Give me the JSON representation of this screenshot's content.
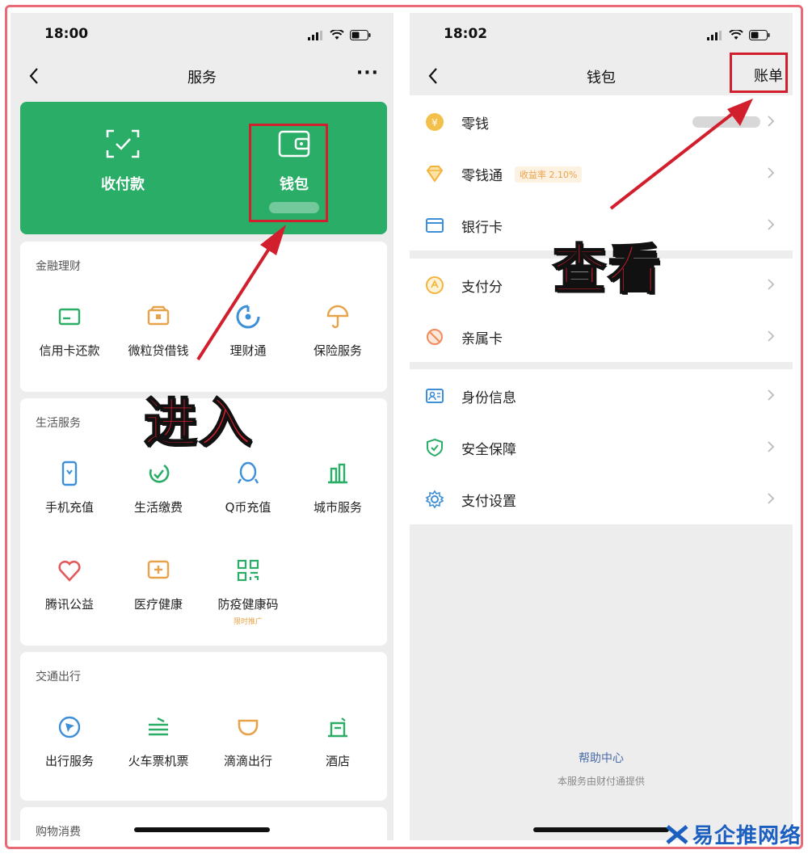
{
  "left": {
    "status_time": "18:00",
    "nav_title": "服务",
    "nav_more": "···",
    "green_card": {
      "pay_label": "收付款",
      "wallet_label": "钱包"
    },
    "finance": {
      "title": "金融理财",
      "items": [
        "信用卡还款",
        "微粒贷借钱",
        "理财通",
        "保险服务"
      ]
    },
    "life": {
      "title": "生活服务",
      "items": [
        "手机充值",
        "生活缴费",
        "Q币充值",
        "城市服务",
        "腾讯公益",
        "医疗健康",
        "防疫健康码"
      ],
      "health_code_sub": "限时推广"
    },
    "transport": {
      "title": "交通出行",
      "items": [
        "出行服务",
        "火车票机票",
        "滴滴出行",
        "酒店"
      ]
    },
    "shopping": {
      "title": "购物消费"
    }
  },
  "right": {
    "status_time": "18:02",
    "nav_title": "钱包",
    "nav_bill": "账单",
    "group1": [
      "零钱",
      "零钱通",
      "银行卡"
    ],
    "lingqiantong_badge": "收益率 2.10%",
    "group2": [
      "支付分",
      "亲属卡"
    ],
    "group3": [
      "身份信息",
      "安全保障",
      "支付设置"
    ],
    "help": "帮助中心",
    "provider": "本服务由财付通提供"
  },
  "annotations": {
    "enter": "进入",
    "view": "查看"
  },
  "watermark": "易企推网络",
  "colors": {
    "green": "#2aad67",
    "annotation_red": "#d21f2d",
    "accent_orange": "#e8a34a",
    "accent_blue": "#3d8fd8",
    "accent_green": "#2aad67"
  }
}
